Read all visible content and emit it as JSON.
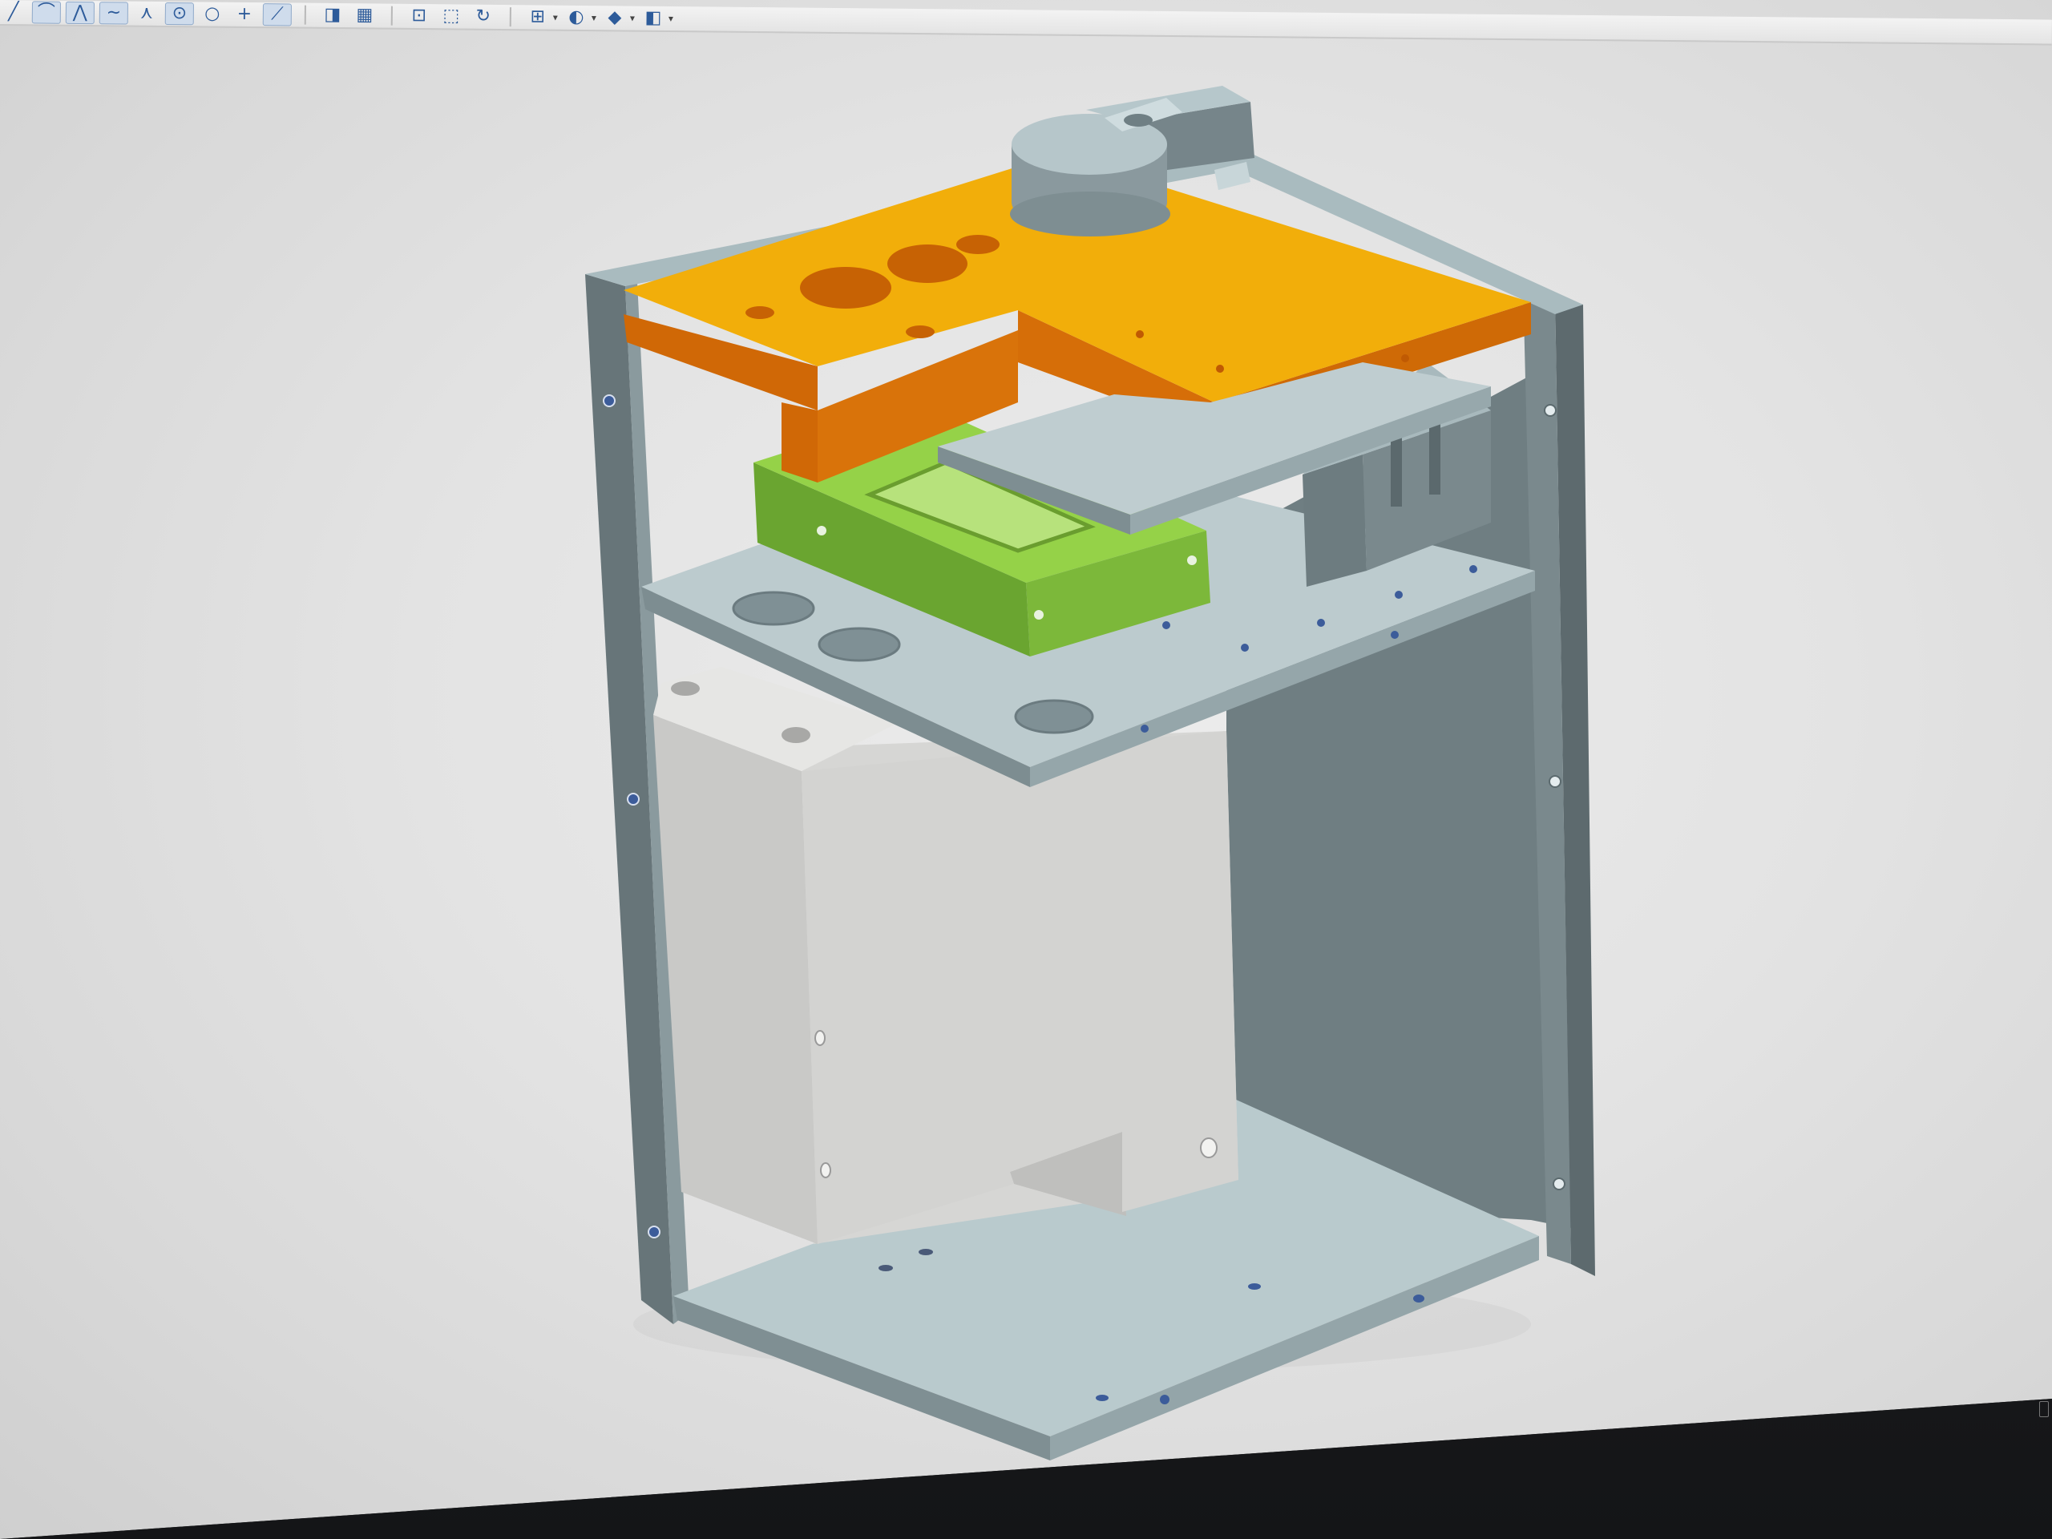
{
  "toolbar": {
    "tools": [
      {
        "name": "sketch-line-icon",
        "glyph": "╱"
      },
      {
        "name": "sketch-arc-icon",
        "glyph": "⌒"
      },
      {
        "name": "sketch-polyline-icon",
        "glyph": "⋀"
      },
      {
        "name": "sketch-spline-icon",
        "glyph": "∼"
      },
      {
        "name": "sketch-intersect-icon",
        "glyph": "⋏"
      },
      {
        "name": "circle-center-icon",
        "glyph": "⊙"
      },
      {
        "name": "circle-icon",
        "glyph": "○"
      },
      {
        "name": "point-icon",
        "glyph": "+"
      },
      {
        "name": "trim-line-icon",
        "glyph": "⟋"
      },
      {
        "name": "extrude-icon",
        "glyph": "◨"
      },
      {
        "name": "pattern-icon",
        "glyph": "▦"
      },
      {
        "name": "zoom-fit-icon",
        "glyph": "⊡"
      },
      {
        "name": "zoom-window-icon",
        "glyph": "⬚"
      },
      {
        "name": "rotate-view-icon",
        "glyph": "↻"
      },
      {
        "name": "view-orientation-icon",
        "glyph": "⊞"
      },
      {
        "name": "display-style-icon",
        "glyph": "◐"
      },
      {
        "name": "render-shaded-icon",
        "glyph": "◆"
      },
      {
        "name": "section-view-icon",
        "glyph": "◧"
      }
    ]
  },
  "colors": {
    "background": "#e6e6e6",
    "frame": "#7d8c90",
    "frame_top": "#b7c8cc",
    "orange_part": "#f0ac08",
    "orange_side": "#d46a06",
    "green_part": "#8acb3c",
    "green_side": "#6ea832",
    "shelf": "#b8c8cc",
    "motor_box": "#d4d4d4"
  }
}
